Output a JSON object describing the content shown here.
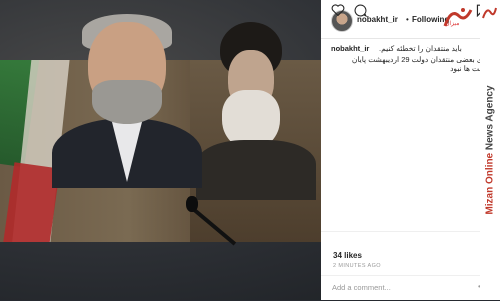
{
  "post": {
    "username": "nobakht_ir",
    "separator": "•",
    "follow_label": "Following",
    "caption_user": "nobakht_ir",
    "caption_line1": "باید منتقدان را تخطئه کنیم.",
    "caption_line2": "برای بعضی منتقدان دولت 29 اردیبهشت پایان رقابت ها نبود",
    "likes": "34 likes",
    "time": "2 MINUTES AGO",
    "comment_placeholder": "Add a comment...",
    "more": "•••"
  },
  "agency": {
    "name_part1": "Mizan Online",
    "name_part2": " News Agency",
    "logo_text": "میزان"
  },
  "icons": {
    "heart": "heart-icon",
    "comment": "comment-icon",
    "bookmark": "bookmark-icon"
  },
  "colors": {
    "accent_red": "#c0392b",
    "text": "#262626",
    "muted": "#999999"
  }
}
